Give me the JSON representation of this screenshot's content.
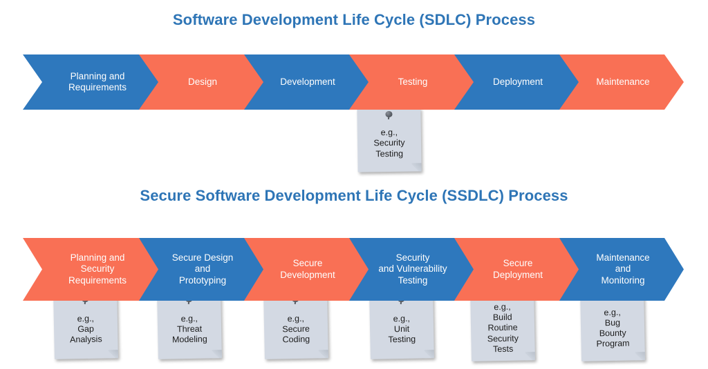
{
  "colors": {
    "blue": "#2e78bd",
    "orange": "#f97055",
    "title_blue": "#2e75b6",
    "note_paper": "#d3d9e3",
    "note_text": "#1b1b1b",
    "chevron_text": "#ffffff",
    "background": "#ffffff"
  },
  "sdlc": {
    "title": "Software Development Life Cycle (SDLC) Process",
    "stages": [
      {
        "label": "Planning and\nRequirements",
        "color": "blue"
      },
      {
        "label": "Design",
        "color": "orange"
      },
      {
        "label": "Development",
        "color": "blue"
      },
      {
        "label": "Testing",
        "color": "orange"
      },
      {
        "label": "Deployment",
        "color": "blue"
      },
      {
        "label": "Maintenance",
        "color": "orange"
      }
    ],
    "notes": [
      {
        "attached_to": "Testing",
        "text": "e.g.,\nSecurity\nTesting",
        "icon": "pushpin-icon"
      }
    ]
  },
  "ssdlc": {
    "title": "Secure Software Development Life Cycle (SSDLC) Process",
    "stages": [
      {
        "label": "Planning and\nSecurity\nRequirements",
        "color": "orange"
      },
      {
        "label": "Secure Design\nand\nPrototyping",
        "color": "blue"
      },
      {
        "label": "Secure\nDevelopment",
        "color": "orange"
      },
      {
        "label": "Security\nand Vulnerability\nTesting",
        "color": "blue"
      },
      {
        "label": "Secure\nDeployment",
        "color": "orange"
      },
      {
        "label": "Maintenance\nand\nMonitoring",
        "color": "blue"
      }
    ],
    "notes": [
      {
        "attached_to": "Planning and Security Requirements",
        "text": "e.g.,\nGap\nAnalysis",
        "icon": "pushpin-icon"
      },
      {
        "attached_to": "Secure Design and Prototyping",
        "text": "e.g.,\nThreat\nModeling",
        "icon": "pushpin-icon"
      },
      {
        "attached_to": "Secure Development",
        "text": "e.g.,\nSecure\nCoding",
        "icon": "pushpin-icon"
      },
      {
        "attached_to": "Security and Vulnerability Testing",
        "text": "e.g.,\nUnit\nTesting",
        "icon": "pushpin-icon"
      },
      {
        "attached_to": "Secure Deployment",
        "text": "e.g.,\nBuild\nRoutine\nSecurity\nTests",
        "icon": "pushpin-icon"
      },
      {
        "attached_to": "Maintenance and Monitoring",
        "text": "e.g.,\nBug\nBounty\nProgram",
        "icon": "pushpin-icon"
      }
    ]
  }
}
